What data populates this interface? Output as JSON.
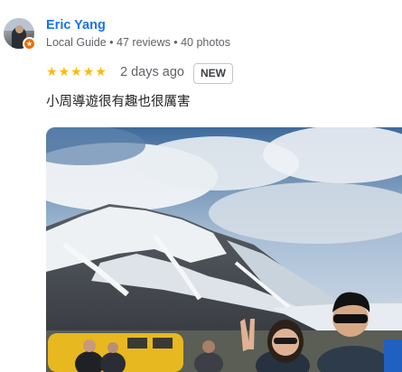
{
  "reviewer": {
    "name": "Eric Yang",
    "details": "Local Guide • 47 reviews • 40 photos",
    "avatar_icon": "user-avatar",
    "badge_icon": "local-guide-star-icon",
    "badge_color": "#e8710a"
  },
  "review": {
    "rating": 5,
    "rating_max": 5,
    "star_icon": "star-icon",
    "star_color": "#fbbc04",
    "date": "2 days ago",
    "tag": "NEW",
    "text": "小周導遊很有趣也很厲害"
  },
  "photo": {
    "subject": "review-photo"
  }
}
